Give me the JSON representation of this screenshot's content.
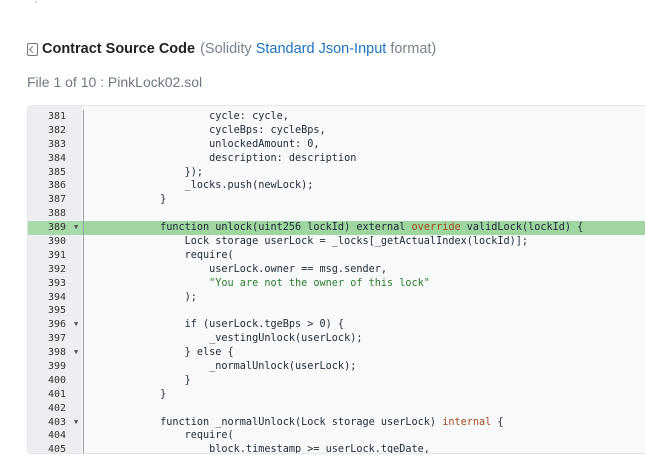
{
  "header": {
    "title": "Contract Source Code",
    "format_open": "(Solidity ",
    "format_link": "Standard Json-Input",
    "format_close": " format)",
    "file_label": "File 1 of 10 : PinkLock02.sol"
  },
  "editor": {
    "lines": [
      {
        "num": "381",
        "fold": false,
        "hl": false,
        "code": "                cycle: cycle,"
      },
      {
        "num": "382",
        "fold": false,
        "hl": false,
        "code": "                cycleBps: cycleBps,"
      },
      {
        "num": "383",
        "fold": false,
        "hl": false,
        "code": "                unlockedAmount: 0,"
      },
      {
        "num": "384",
        "fold": false,
        "hl": false,
        "code": "                description: description"
      },
      {
        "num": "385",
        "fold": false,
        "hl": false,
        "code": "            });"
      },
      {
        "num": "386",
        "fold": false,
        "hl": false,
        "code": "            _locks.push(newLock);"
      },
      {
        "num": "387",
        "fold": false,
        "hl": false,
        "code": "        }"
      },
      {
        "num": "388",
        "fold": false,
        "hl": false,
        "code": ""
      },
      {
        "num": "389",
        "fold": true,
        "hl": true,
        "code": "        function unlock(uint256 lockId) external override validLock(lockId) {"
      },
      {
        "num": "390",
        "fold": false,
        "hl": false,
        "code": "            Lock storage userLock = _locks[_getActualIndex(lockId)];"
      },
      {
        "num": "391",
        "fold": false,
        "hl": false,
        "code": "            require("
      },
      {
        "num": "392",
        "fold": false,
        "hl": false,
        "code": "                userLock.owner == msg.sender,"
      },
      {
        "num": "393",
        "fold": false,
        "hl": false,
        "code": "                \"You are not the owner of this lock\""
      },
      {
        "num": "394",
        "fold": false,
        "hl": false,
        "code": "            );"
      },
      {
        "num": "395",
        "fold": false,
        "hl": false,
        "code": ""
      },
      {
        "num": "396",
        "fold": true,
        "hl": false,
        "code": "            if (userLock.tgeBps > 0) {"
      },
      {
        "num": "397",
        "fold": false,
        "hl": false,
        "code": "                _vestingUnlock(userLock);"
      },
      {
        "num": "398",
        "fold": true,
        "hl": false,
        "code": "            } else {"
      },
      {
        "num": "399",
        "fold": false,
        "hl": false,
        "code": "                _normalUnlock(userLock);"
      },
      {
        "num": "400",
        "fold": false,
        "hl": false,
        "code": "            }"
      },
      {
        "num": "401",
        "fold": false,
        "hl": false,
        "code": "        }"
      },
      {
        "num": "402",
        "fold": false,
        "hl": false,
        "code": ""
      },
      {
        "num": "403",
        "fold": true,
        "hl": false,
        "code": "        function _normalUnlock(Lock storage userLock) internal {"
      },
      {
        "num": "404",
        "fold": false,
        "hl": false,
        "code": "            require("
      },
      {
        "num": "405",
        "fold": false,
        "hl": false,
        "code": "                block.timestamp >= userLock.tgeDate,"
      }
    ]
  },
  "colors": {
    "highlight": "#9fd6a0",
    "link": "#1e73be",
    "keyword": "#a04a1d",
    "string": "#2a7d2a"
  },
  "icons": {
    "title_icon": "code-file-icon",
    "fold_icon": "chevron-down-icon"
  }
}
